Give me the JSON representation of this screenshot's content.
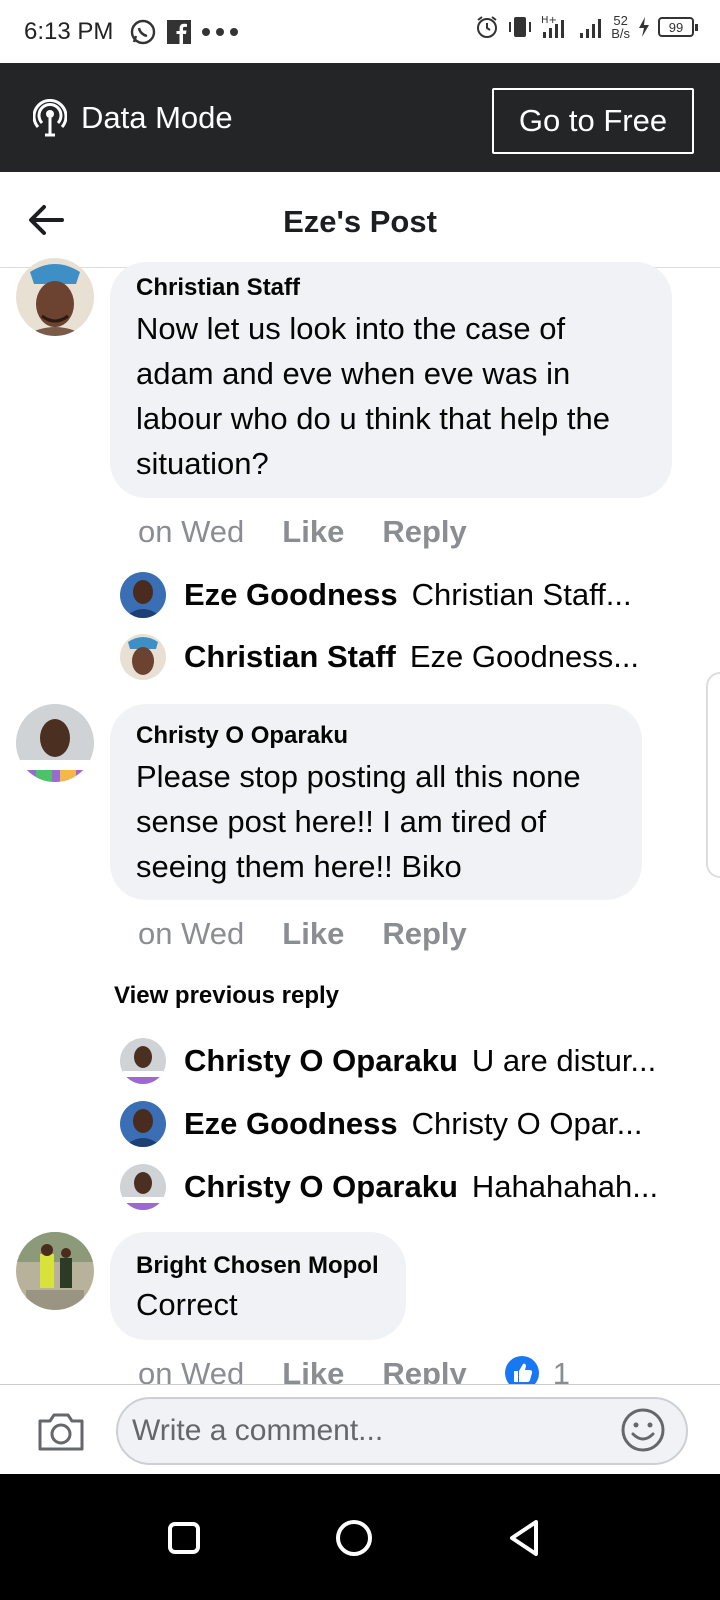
{
  "status_bar": {
    "time": "6:13 PM",
    "net_speed_value": "52",
    "net_speed_unit": "B/s",
    "network_type": "H+",
    "battery": "99"
  },
  "data_mode": {
    "label": "Data Mode",
    "go_free_label": "Go to Free"
  },
  "header": {
    "title": "Eze's Post"
  },
  "comments": [
    {
      "author": "Christian Staff",
      "text": "Now let us look into the case of adam and eve when eve was in labour who do u think that help the situation?",
      "time": "on Wed",
      "like_label": "Like",
      "reply_label": "Reply",
      "replies": [
        {
          "author": "Eze Goodness",
          "text": "Christian Staff..."
        },
        {
          "author": "Christian Staff",
          "text": "Eze Goodness..."
        }
      ]
    },
    {
      "author": "Christy O Oparaku",
      "text": "Please stop posting all this none sense post here!! I am tired of seeing them here!! Biko",
      "time": "on Wed",
      "like_label": "Like",
      "reply_label": "Reply",
      "view_previous_label": "View previous reply",
      "replies": [
        {
          "author": "Christy O Oparaku",
          "text": "U are distur..."
        },
        {
          "author": "Eze Goodness",
          "text": "Christy O Opar..."
        },
        {
          "author": "Christy O Oparaku",
          "text": "Hahahahah..."
        }
      ]
    },
    {
      "author": "Bright Chosen Mopol",
      "text": "Correct",
      "time": "on Wed",
      "like_label": "Like",
      "reply_label": "Reply",
      "reaction_count": "1"
    }
  ],
  "composer": {
    "placeholder": "Write a comment..."
  },
  "colors": {
    "data_mode_bg": "#242526",
    "bubble_bg": "#f0f2f5",
    "like_blue": "#1877f2",
    "muted_text": "#8a8d91"
  }
}
